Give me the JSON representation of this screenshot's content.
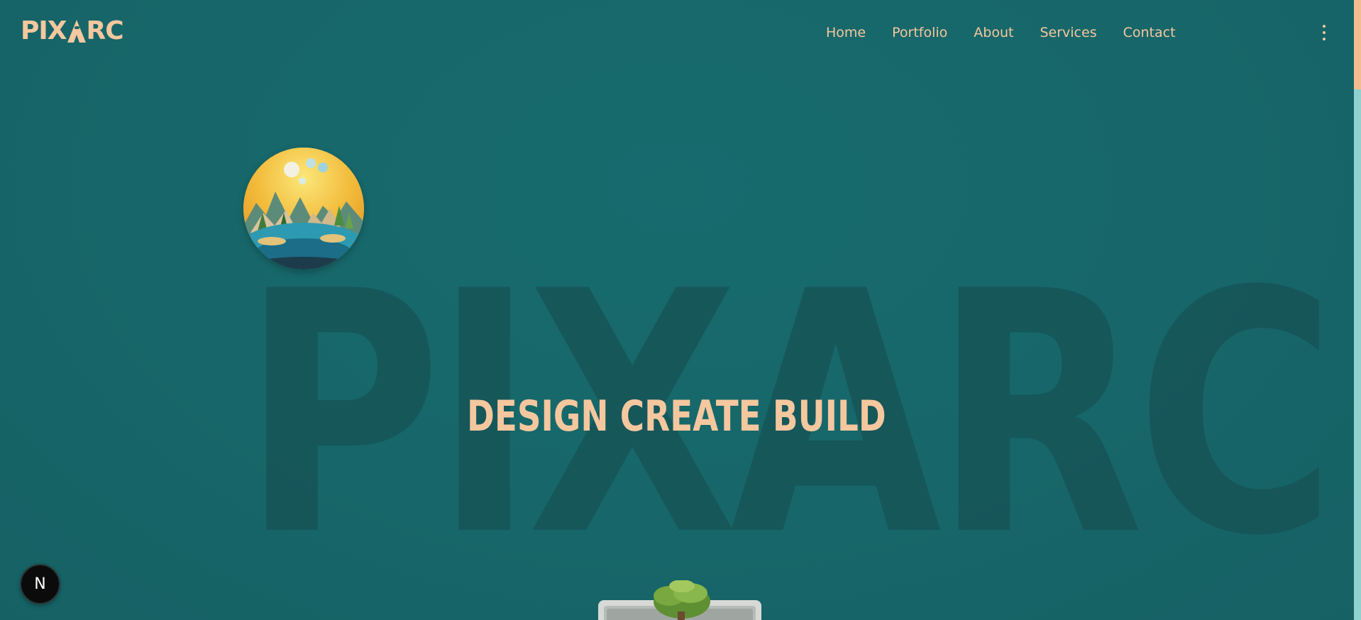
{
  "header": {
    "logo": {
      "prefix": "PIX",
      "suffix": "RC"
    },
    "nav": {
      "items": [
        {
          "label": "Home"
        },
        {
          "label": "Portfolio"
        },
        {
          "label": "About"
        },
        {
          "label": "Services"
        },
        {
          "label": "Contact"
        }
      ]
    },
    "menu_icon": "more-vertical-icon"
  },
  "hero": {
    "background_word": "PIXARC",
    "tagline": "DESIGN CREATE BUILD"
  },
  "badge": {
    "label": "N"
  },
  "colors": {
    "background": "#17676a",
    "accent": "#f5c79e",
    "background_word": "#165255",
    "scroll_track": "#8fd2ce",
    "scroll_thumb": "#f3bd8f"
  }
}
